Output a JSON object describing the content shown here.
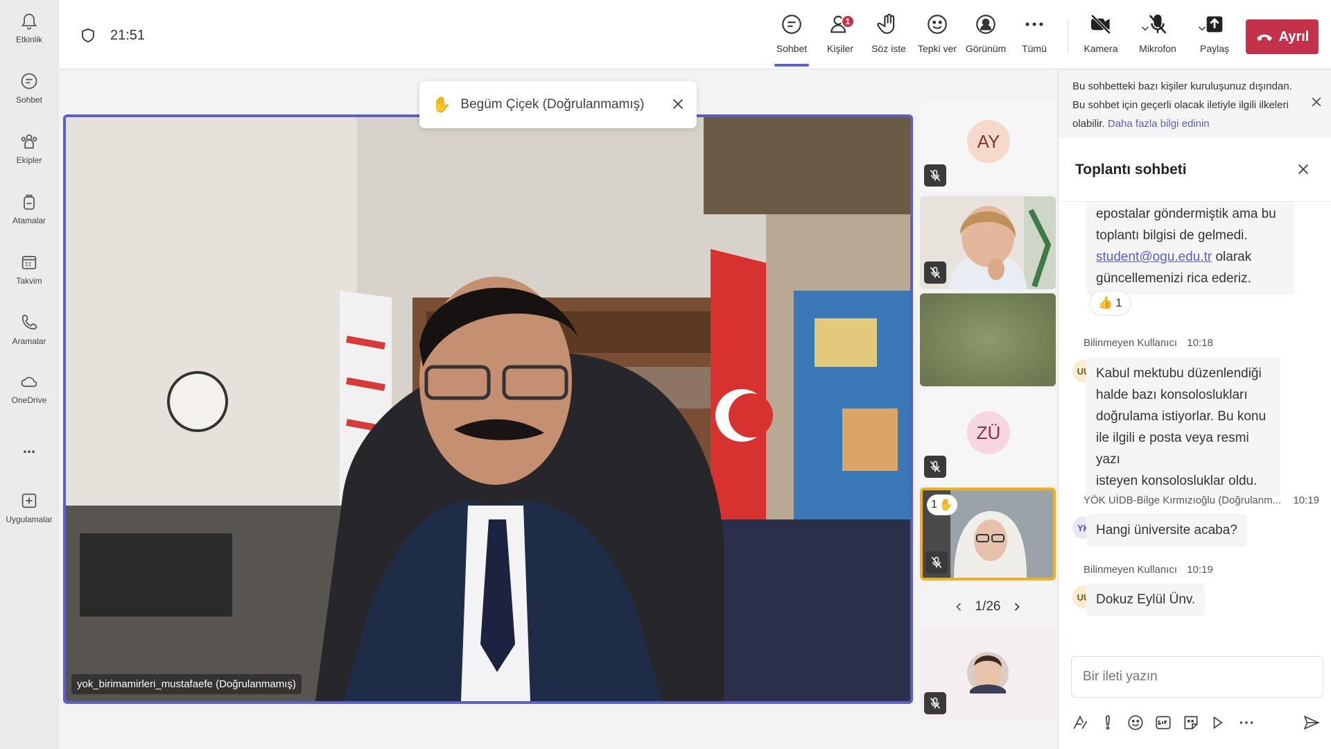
{
  "rail": {
    "items": [
      {
        "label": "Etkinlik",
        "icon": "bell-icon"
      },
      {
        "label": "Sohbet",
        "icon": "chat-icon"
      },
      {
        "label": "Ekipler",
        "icon": "teams-icon"
      },
      {
        "label": "Atamalar",
        "icon": "backpack-icon"
      },
      {
        "label": "Takvim",
        "icon": "calendar-icon"
      },
      {
        "label": "Aramalar",
        "icon": "phone-icon"
      },
      {
        "label": "OneDrive",
        "icon": "cloud-icon"
      },
      {
        "label": "...",
        "icon": "more-icon"
      },
      {
        "label": "Uygulamalar",
        "icon": "add-app-icon"
      }
    ]
  },
  "topbar": {
    "timer": "21:51",
    "buttons": {
      "chat": "Sohbet",
      "people": "Kişiler",
      "people_badge": "1",
      "raise_hand": "Söz iste",
      "react": "Tepki ver",
      "view": "Görünüm",
      "more": "Tümü",
      "camera": "Kamera",
      "mic": "Mikrofon",
      "share": "Paylaş"
    },
    "leave_label": "Ayrıl"
  },
  "stage": {
    "toast": "Begüm Çiçek (Doğrulanmamış)",
    "main_name": "yok_birimamirleri_mustafaefe (Doğrulanmamış)",
    "tiles": [
      {
        "initials": "AY"
      },
      {
        "initials": ""
      },
      {
        "initials": ""
      },
      {
        "initials": "ZÜ"
      },
      {
        "initials": "",
        "hand_count": "1"
      },
      {
        "initials": ""
      }
    ],
    "pager": "1/26"
  },
  "chat": {
    "notice_text": "Bu sohbetteki bazı kişiler kuruluşunuz dışından. Bu sohbet için geçerli olacak iletiyle ilgili ilkeleri olabilir.",
    "notice_link": "Daha fazla bilgi edinin",
    "title": "Toplantı sohbeti",
    "msg1_line1": "epostalar göndermiştik ama bu",
    "msg1_line2": "toplantı bilgisi de gelmedi.",
    "msg1_link": "student@ogu.edu.tr",
    "msg1_line3_rest": " olarak",
    "msg1_line4": "güncellemenizi rica ederiz.",
    "msg1_reaction": "1",
    "msg2_sender": "Bilinmeyen Kullanıcı",
    "msg2_time": "10:18",
    "msg2_avatar": "UU",
    "msg2_lines": [
      "Kabul mektubu düzenlendiği",
      "halde bazı konsoloslukları",
      "doğrulama istiyorlar. Bu konu",
      "ile ilgili e posta veya resmi yazı",
      "isteyen konsolosluklar oldu."
    ],
    "msg3_sender": "YÖK UİDB-Bilge Kırmızıoğlu (Doğrulanm...",
    "msg3_time": "10:19",
    "msg3_avatar": "YK",
    "msg3_text": "Hangi üniversite acaba?",
    "msg4_sender": "Bilinmeyen Kullanıcı",
    "msg4_time": "10:19",
    "msg4_avatar": "UU",
    "msg4_text": "Dokuz Eylül Ünv.",
    "compose_placeholder": "Bir ileti yazın"
  }
}
